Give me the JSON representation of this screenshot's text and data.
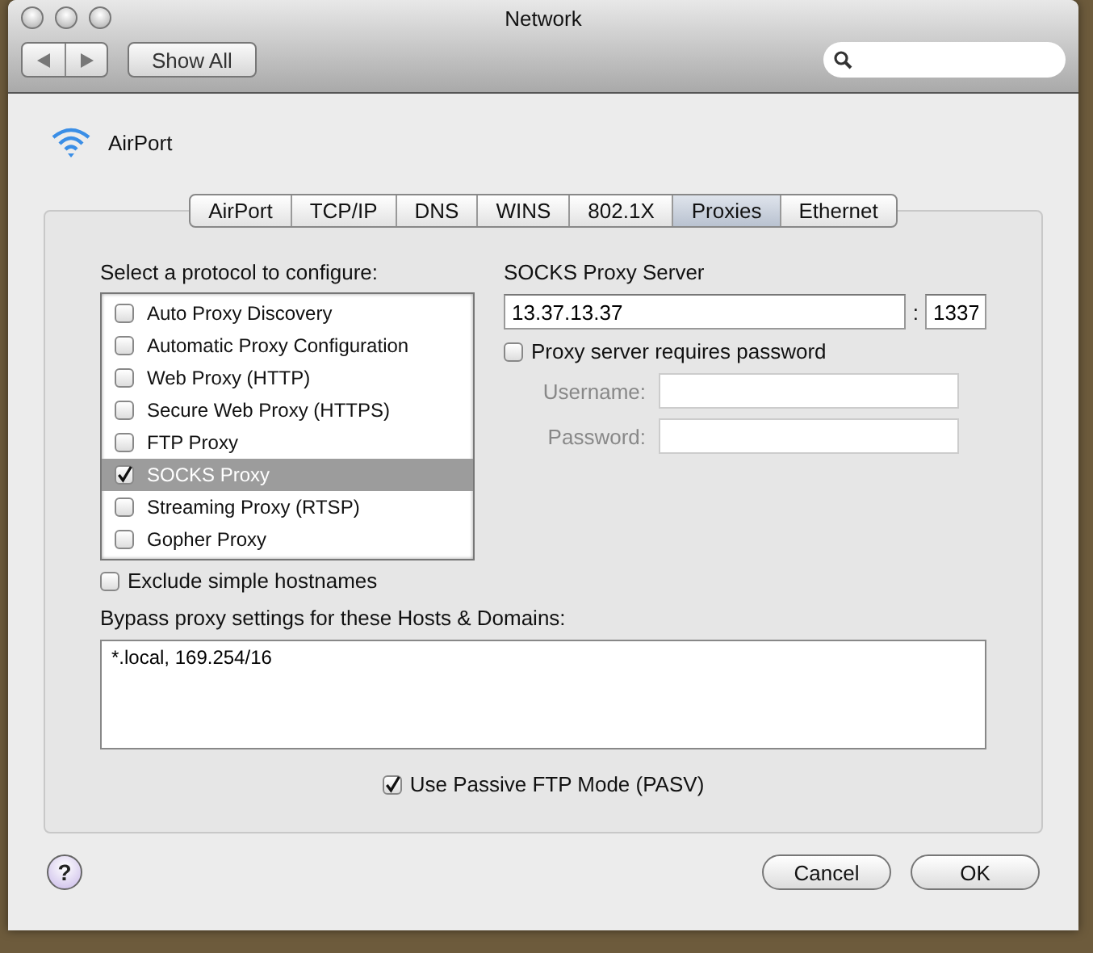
{
  "window": {
    "title": "Network"
  },
  "toolbar": {
    "show_all": "Show All"
  },
  "service": {
    "name": "AirPort"
  },
  "tabs": [
    {
      "label": "AirPort",
      "selected": false
    },
    {
      "label": "TCP/IP",
      "selected": false
    },
    {
      "label": "DNS",
      "selected": false
    },
    {
      "label": "WINS",
      "selected": false
    },
    {
      "label": "802.1X",
      "selected": false
    },
    {
      "label": "Proxies",
      "selected": true
    },
    {
      "label": "Ethernet",
      "selected": false
    }
  ],
  "protocols": {
    "heading": "Select a protocol to configure:",
    "items": [
      {
        "label": "Auto Proxy Discovery",
        "checked": false,
        "selected": false
      },
      {
        "label": "Automatic Proxy Configuration",
        "checked": false,
        "selected": false
      },
      {
        "label": "Web Proxy (HTTP)",
        "checked": false,
        "selected": false
      },
      {
        "label": "Secure Web Proxy (HTTPS)",
        "checked": false,
        "selected": false
      },
      {
        "label": "FTP Proxy",
        "checked": false,
        "selected": false
      },
      {
        "label": "SOCKS Proxy",
        "checked": true,
        "selected": true
      },
      {
        "label": "Streaming Proxy (RTSP)",
        "checked": false,
        "selected": false
      },
      {
        "label": "Gopher Proxy",
        "checked": false,
        "selected": false
      }
    ]
  },
  "exclude_simple": {
    "label": "Exclude simple hostnames",
    "checked": false
  },
  "server": {
    "heading": "SOCKS Proxy Server",
    "host": "13.37.13.37",
    "separator": ":",
    "port": "1337",
    "requires_password": {
      "label": "Proxy server requires password",
      "checked": false
    },
    "credentials": [
      {
        "label": "Username:",
        "disabled": true
      },
      {
        "label": "Password:",
        "disabled": true
      }
    ]
  },
  "bypass": {
    "label": "Bypass proxy settings for these Hosts & Domains:",
    "value": "*.local, 169.254/16"
  },
  "passive_ftp": {
    "label": "Use Passive FTP Mode (PASV)",
    "checked": true
  },
  "buttons": [
    {
      "label": "Cancel",
      "default": false
    },
    {
      "label": "OK",
      "default": false
    }
  ],
  "help": "?"
}
